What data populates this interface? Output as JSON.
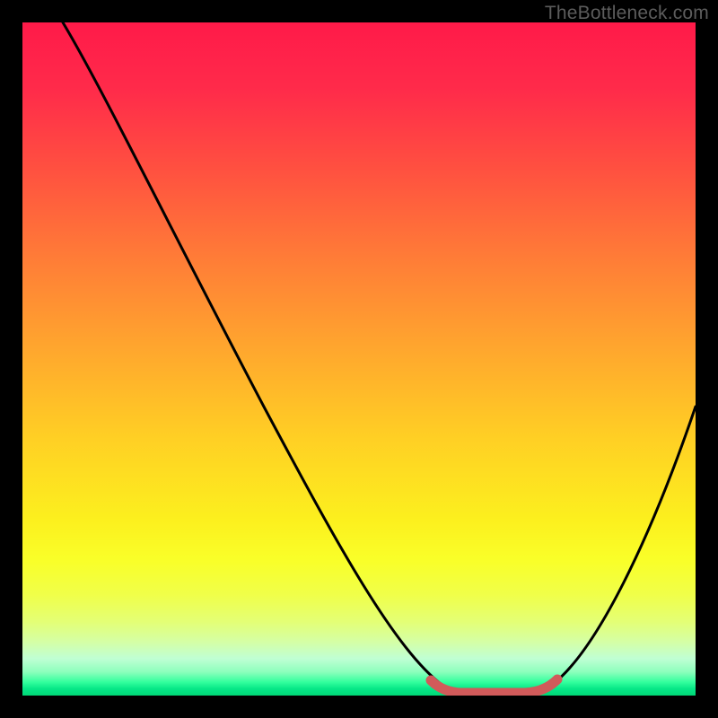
{
  "watermark": "TheBottleneck.com",
  "colors": {
    "frame": "#000000",
    "gradient_top": "#ff1a49",
    "gradient_mid": "#ffd024",
    "gradient_bottom": "#00d877",
    "curve": "#000000",
    "trough_red": "#d15a5a"
  },
  "chart_data": {
    "type": "line",
    "title": "",
    "xlabel": "",
    "ylabel": "",
    "xlim": [
      0,
      100
    ],
    "ylim": [
      0,
      100
    ],
    "grid": false,
    "legend": false,
    "series": [
      {
        "name": "bottleneck-curve",
        "x": [
          0,
          5,
          10,
          15,
          20,
          25,
          30,
          35,
          40,
          45,
          50,
          54,
          58,
          62,
          66,
          70,
          73,
          76,
          80,
          84,
          88,
          92,
          96,
          100
        ],
        "values": [
          100,
          94,
          87,
          80,
          72,
          65,
          57,
          49,
          41,
          33,
          25,
          18,
          12,
          6,
          2,
          0,
          0,
          0,
          3,
          8,
          15,
          23,
          32,
          43
        ]
      },
      {
        "name": "trough-highlight",
        "x": [
          62,
          66,
          70,
          73,
          76,
          79
        ],
        "values": [
          2,
          0.5,
          0,
          0,
          0.5,
          2
        ]
      }
    ],
    "annotations": []
  }
}
